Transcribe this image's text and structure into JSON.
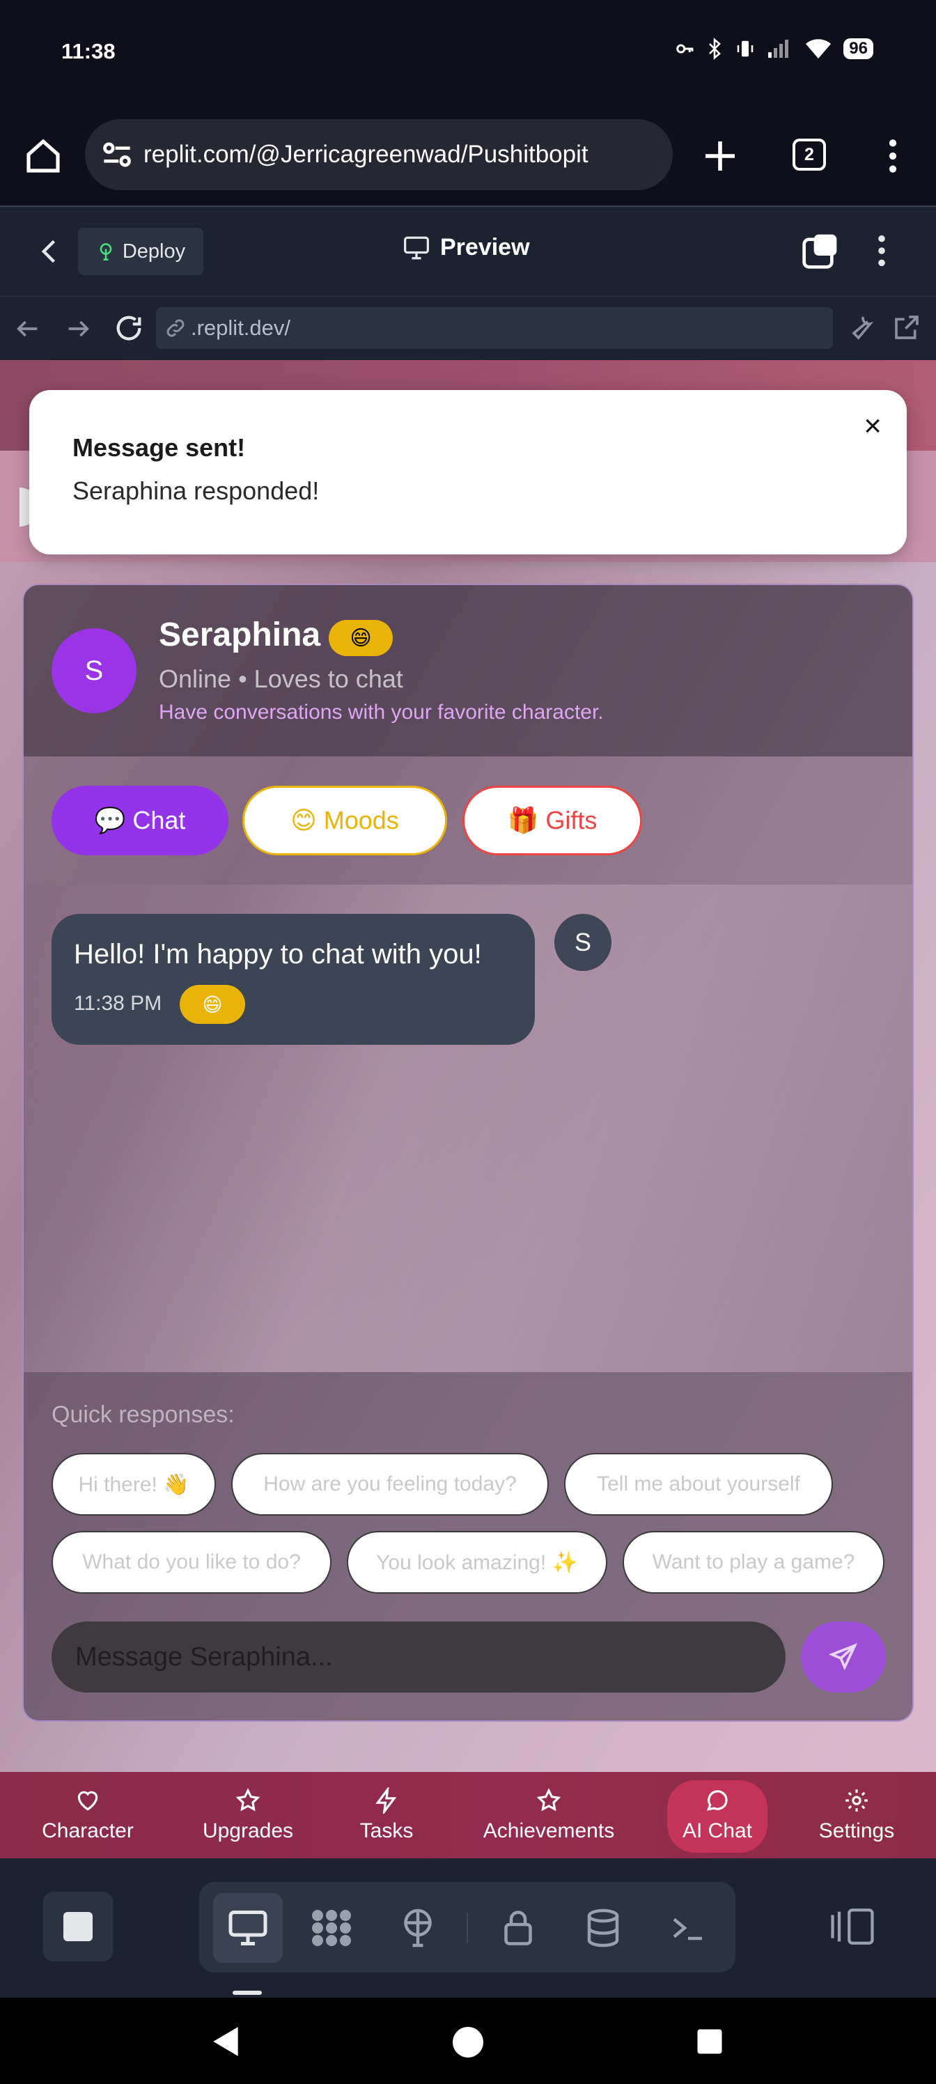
{
  "status_bar": {
    "time": "11:38",
    "battery": "96"
  },
  "browser": {
    "url": "replit.com/@Jerricagreenwad/Pushitbopit",
    "tab_count": "2"
  },
  "replit": {
    "deploy_label": "Deploy",
    "preview_label": "Preview",
    "webview_url": ".replit.dev/"
  },
  "toast": {
    "title": "Message sent!",
    "body": "Seraphina responded!",
    "close": "×"
  },
  "character": {
    "initial": "S",
    "name": "Seraphina",
    "mood_emoji": "😄",
    "status": "Online • Loves to chat",
    "description": "Have conversations with your favorite character."
  },
  "tabs": [
    {
      "label": "💬 Chat"
    },
    {
      "label": "😊 Moods"
    },
    {
      "label": "🎁 Gifts"
    }
  ],
  "messages": [
    {
      "text": "Hello! I'm happy to chat with you!",
      "time": "11:38 PM",
      "mood": "😄",
      "avatar": "S"
    }
  ],
  "quick_responses": {
    "label": "Quick responses:",
    "items": [
      "Hi there! 👋",
      "How are you feeling today?",
      "Tell me about yourself",
      "What do you like to do?",
      "You look amazing! ✨",
      "Want to play a game?"
    ]
  },
  "composer": {
    "placeholder": "Message Seraphina..."
  },
  "app_nav": [
    {
      "label": "Character",
      "icon": "heart-icon"
    },
    {
      "label": "Upgrades",
      "icon": "star-icon"
    },
    {
      "label": "Tasks",
      "icon": "lightning-icon"
    },
    {
      "label": "Achievements",
      "icon": "star-icon"
    },
    {
      "label": "AI Chat",
      "icon": "chat-bubble-icon"
    },
    {
      "label": "Settings",
      "icon": "gear-icon"
    }
  ],
  "colors": {
    "accent_purple": "#9333ea",
    "mood_yellow": "#eab308",
    "gifts_red": "#ef4444",
    "nav_active": "#c43458"
  }
}
